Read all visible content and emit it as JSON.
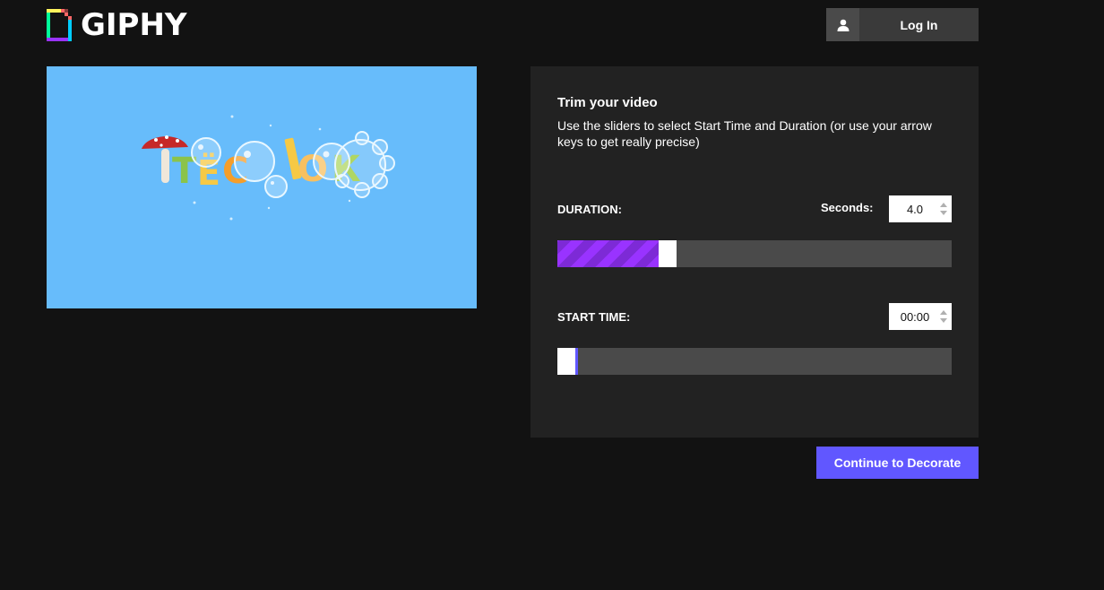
{
  "header": {
    "logo_text": "GIPHY",
    "login_label": "Log In",
    "login_icon": "user-icon"
  },
  "preview": {
    "logo_letters": [
      "Т",
      "Ё",
      "С",
      "О",
      "К"
    ]
  },
  "trim": {
    "title": "Trim your video",
    "description": "Use the sliders to select Start Time and Duration (or use your arrow keys to get really precise)",
    "duration": {
      "label": "DURATION:",
      "seconds_label": "Seconds:",
      "value": "4.0",
      "slider_fraction": 0.27
    },
    "start_time": {
      "label": "START TIME:",
      "value": "00:00",
      "slider_fraction": 0.0
    }
  },
  "actions": {
    "continue_label": "Continue to Decorate"
  },
  "colors": {
    "background": "#121212",
    "panel": "#222222",
    "track": "#4a4a4a",
    "accent_purple": "#9933ff",
    "button_blue": "#6157ff",
    "preview_bg": "#67bcfb"
  }
}
